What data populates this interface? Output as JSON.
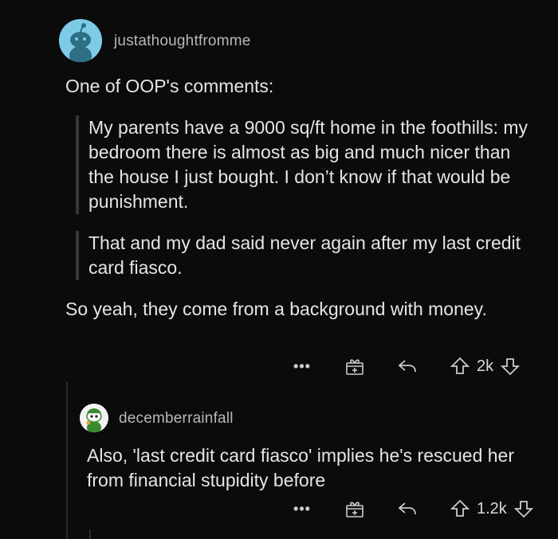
{
  "comment": {
    "username": "justathoughtfromme",
    "intro": "One of OOP's comments:",
    "quotes": [
      "My parents have a 9000 sq/ft home in the foothills: my bedroom there is almost as big and much nicer than the house I just bought. I don’t know if that would be punishment.",
      "That and my dad said never again after my last credit card fiasco."
    ],
    "outro": "So yeah, they come from a background with money.",
    "actions": {
      "more": "•••",
      "votes": "2k"
    }
  },
  "reply": {
    "username": "decemberrainfall",
    "body": "Also, 'last credit card fiasco' implies he's rescued her from financial stupidity before",
    "actions": {
      "more": "•••",
      "votes": "1.2k"
    }
  },
  "colors": {
    "background": "#0b0b0b",
    "text": "#e3e5e6",
    "muted": "#b5b8bb",
    "avatar_blue": "#7ecbe8"
  },
  "icons": [
    "award-icon",
    "reply-icon",
    "upvote-icon",
    "downvote-icon",
    "more-icon"
  ]
}
